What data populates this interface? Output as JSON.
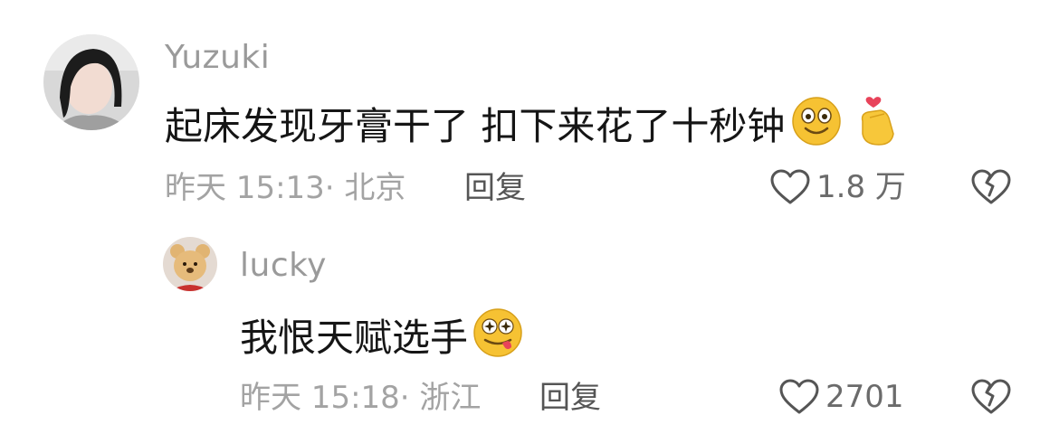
{
  "comments": [
    {
      "username": "Yuzuki",
      "text": "起床发现牙膏干了 扣下来花了十秒钟",
      "emojis": [
        "smiling-face-emoji",
        "finger-heart-emoji"
      ],
      "timestamp": "昨天 15:13",
      "location": "北京",
      "meta": "昨天 15:13· 北京",
      "reply_label": "回复",
      "likes": "1.8 万"
    },
    {
      "username": "lucky",
      "text": "我恨天赋选手",
      "emojis": [
        "zany-star-eyes-emoji"
      ],
      "timestamp": "昨天 15:18",
      "location": "浙江",
      "meta": "昨天 15:18· 浙江",
      "reply_label": "回复",
      "likes": "2701"
    }
  ],
  "icons": {
    "like": "heart-outline-icon",
    "dislike": "broken-heart-icon"
  },
  "colors": {
    "text": "#151515",
    "muted": "#a3a3a3",
    "username": "#9a9a9a"
  }
}
